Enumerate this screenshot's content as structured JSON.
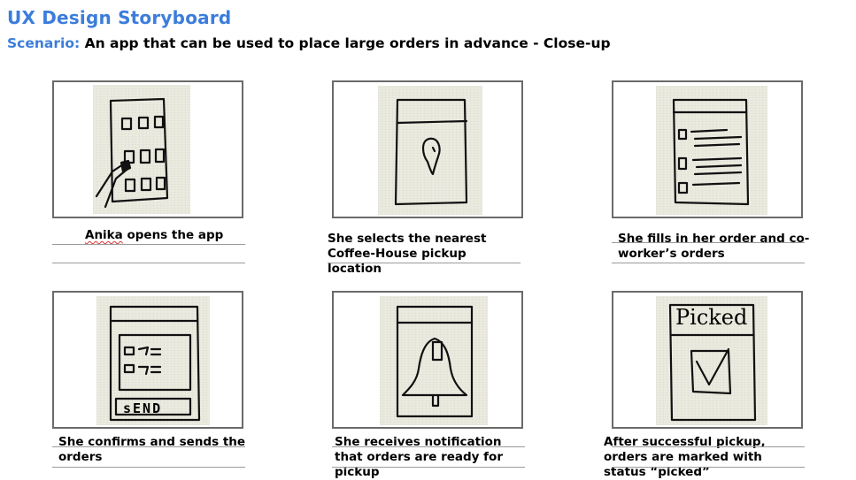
{
  "header": {
    "title": "UX Design Storyboard",
    "scenario_label": "Scenario:",
    "scenario_text": "An app that can be used to place large orders in advance - Close-up"
  },
  "panels": [
    {
      "caption_a": "Anika",
      "caption_b": " opens the app",
      "icon": "app-grid-sketch"
    },
    {
      "caption": "She selects the nearest Coffee-House pickup location",
      "icon": "map-pin-sketch"
    },
    {
      "caption": "She fills in her order and co-worker’s orders",
      "icon": "order-list-sketch"
    },
    {
      "caption": "She confirms and sends the orders",
      "icon": "send-orders-sketch"
    },
    {
      "caption": "She receives notification that orders are ready for pickup",
      "icon": "bell-notification-sketch"
    },
    {
      "caption": "After successful pickup, orders are marked with status “picked”",
      "icon": "picked-status-sketch"
    }
  ],
  "sketch_text": {
    "send": "sEND",
    "picked": "Picked"
  }
}
